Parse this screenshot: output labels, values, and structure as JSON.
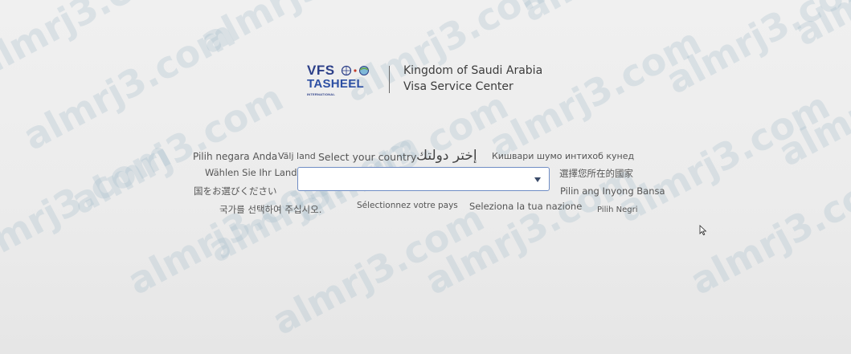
{
  "watermark": {
    "text": "almrj3.com",
    "color": "#a0b9c8"
  },
  "header": {
    "logo_vfs": "VFS",
    "logo_tasheel": "TASHEEL",
    "logo_international": "INTERNATIONAL",
    "title_line1": "Kingdom of Saudi Arabia",
    "title_line2": "Visa Service Center",
    "brand_color": "#2c3f88"
  },
  "country_prompts": {
    "malay": "Pilih negara Anda",
    "swedish": "Välj land",
    "english": "Select your country",
    "arabic": "إختر دولتك",
    "tajik": "Кишвари шумо интихоб кунед",
    "german": "Wählen Sie Ihr Land",
    "chinese": "選擇您所在的國家",
    "japanese": "国をお選びください",
    "filipino": "Pilin ang Inyong Bansa",
    "korean": "국가를 선택하여 주십시오.",
    "french": "Sélectionnez votre pays",
    "italian": "Seleziona la tua nazione",
    "indonesian": "Pilih Negri"
  },
  "country_select": {
    "selected_value": "",
    "border_color": "#6f8cc4"
  },
  "icons": {
    "caret": "chevron-down-icon",
    "cursor": "mouse-pointer-icon",
    "logo_mark": "globe-icon"
  }
}
